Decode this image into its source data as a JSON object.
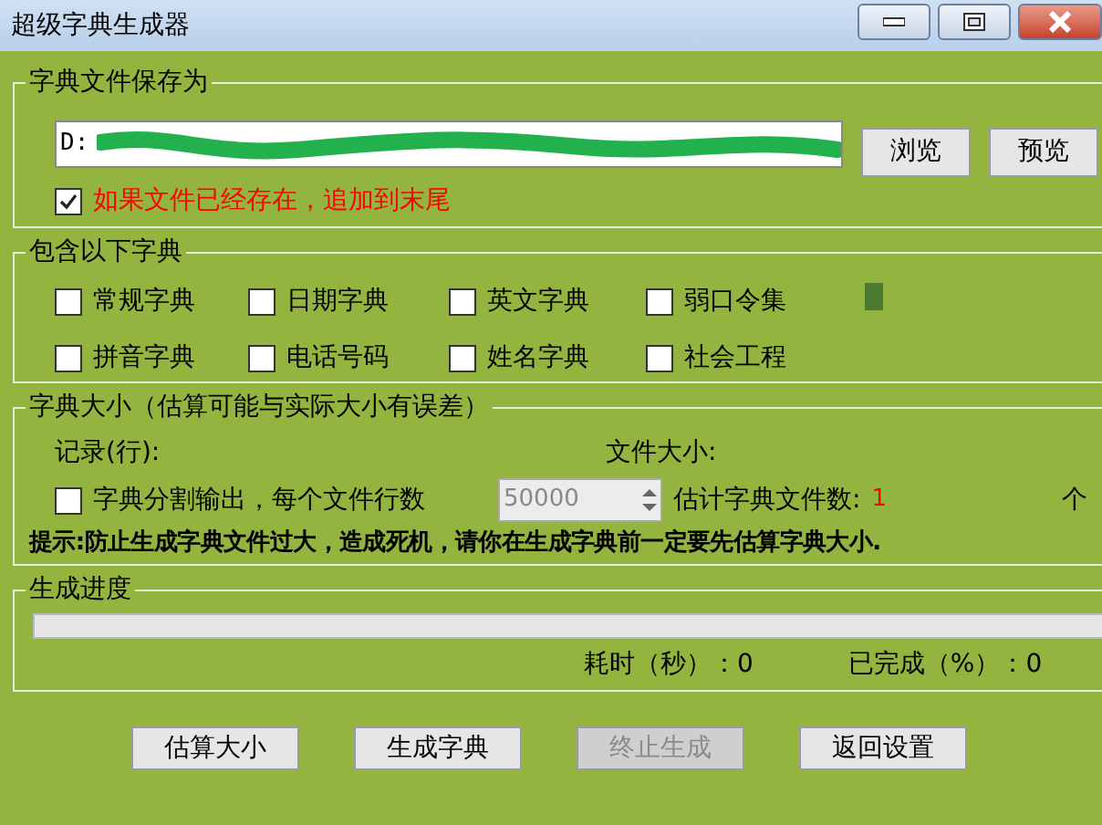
{
  "window": {
    "title": "超级字典生成器",
    "controls": [
      {
        "kind": "minimize"
      },
      {
        "kind": "maximize"
      },
      {
        "kind": "close"
      }
    ]
  },
  "save_group": {
    "legend": "字典文件保存为",
    "path": {
      "value": "D:",
      "redacted": true
    },
    "buttons": [
      {
        "label": "浏览",
        "disabled": false
      },
      {
        "label": "预览",
        "disabled": false
      }
    ],
    "append": {
      "label": "如果文件已经存在，追加到末尾",
      "checked": true
    }
  },
  "dict_group": {
    "legend": "包含以下字典",
    "options": [
      {
        "label": "常规字典",
        "checked": false
      },
      {
        "label": "日期字典",
        "checked": false
      },
      {
        "label": "英文字典",
        "checked": false
      },
      {
        "label": "弱口令集",
        "checked": false
      },
      {
        "label": "拼音字典",
        "checked": false
      },
      {
        "label": "电话号码",
        "checked": false
      },
      {
        "label": "姓名字典",
        "checked": false
      },
      {
        "label": "社会工程",
        "checked": false
      }
    ]
  },
  "size_group": {
    "legend": "字典大小（估算可能与实际大小有误差）",
    "records_label": "记录(行):",
    "file_size_label": "文件大小:",
    "split": {
      "label": "字典分割输出，每个文件行数",
      "checked": false
    },
    "lines_per_file": "50000",
    "estimate_label": "估计字典文件数:",
    "estimate_value": "1",
    "unit": "个",
    "hint": "**提示:**防止生成字典文件过大，造成死机，请你在生成字典前一定要先估算字典大小."
  },
  "progress_group": {
    "legend": "生成进度",
    "level": 0,
    "elapsed": "耗时（秒）：0",
    "done": "已完成（%）：0"
  },
  "buttons": [
    {
      "label": "估算大小",
      "disabled": false
    },
    {
      "label": "生成字典",
      "disabled": false
    },
    {
      "label": "终止生成",
      "disabled": true
    },
    {
      "label": "返回设置",
      "disabled": false
    }
  ]
}
